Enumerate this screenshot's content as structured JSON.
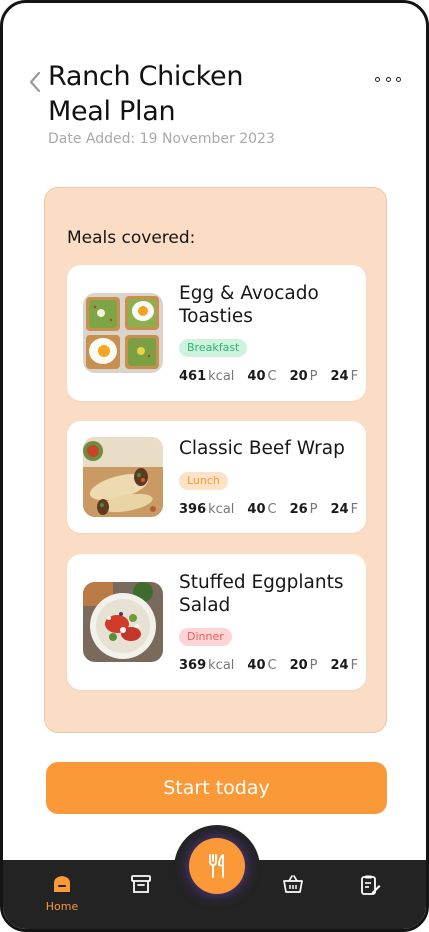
{
  "header": {
    "title_line1": "Ranch Chicken",
    "title_line2": "Meal Plan",
    "date_added": "Date Added: 19 November 2023"
  },
  "panel": {
    "heading": "Meals covered:"
  },
  "meals": [
    {
      "name_line1": "Egg & Avocado",
      "name_line2": "Toasties",
      "tag": "Breakfast",
      "kcal": "461",
      "kcal_unit": "kcal",
      "carbs": "40",
      "carbs_unit": "C",
      "protein": "20",
      "protein_unit": "P",
      "fat": "24",
      "fat_unit": "F"
    },
    {
      "name_line1": "Classic Beef Wrap",
      "name_line2": "",
      "tag": "Lunch",
      "kcal": "396",
      "kcal_unit": "kcal",
      "carbs": "40",
      "carbs_unit": "C",
      "protein": "26",
      "protein_unit": "P",
      "fat": "24",
      "fat_unit": "F"
    },
    {
      "name_line1": "Stuffed Eggplants",
      "name_line2": "Salad",
      "tag": "Dinner",
      "kcal": "369",
      "kcal_unit": "kcal",
      "carbs": "40",
      "carbs_unit": "C",
      "protein": "20",
      "protein_unit": "P",
      "fat": "24",
      "fat_unit": "F"
    }
  ],
  "actions": {
    "start_label": "Start today"
  },
  "nav": {
    "home_label": "Home",
    "items": [
      "home-icon",
      "archive-icon",
      "fork-knife-icon",
      "basket-icon",
      "clipboard-edit-icon"
    ]
  },
  "colors": {
    "accent": "#fb9837",
    "panel_bg": "#fbdcc5",
    "nav_bg": "#232323",
    "breakfast": "#33b26d",
    "lunch": "#f49a3a",
    "dinner": "#ee5b5b"
  }
}
